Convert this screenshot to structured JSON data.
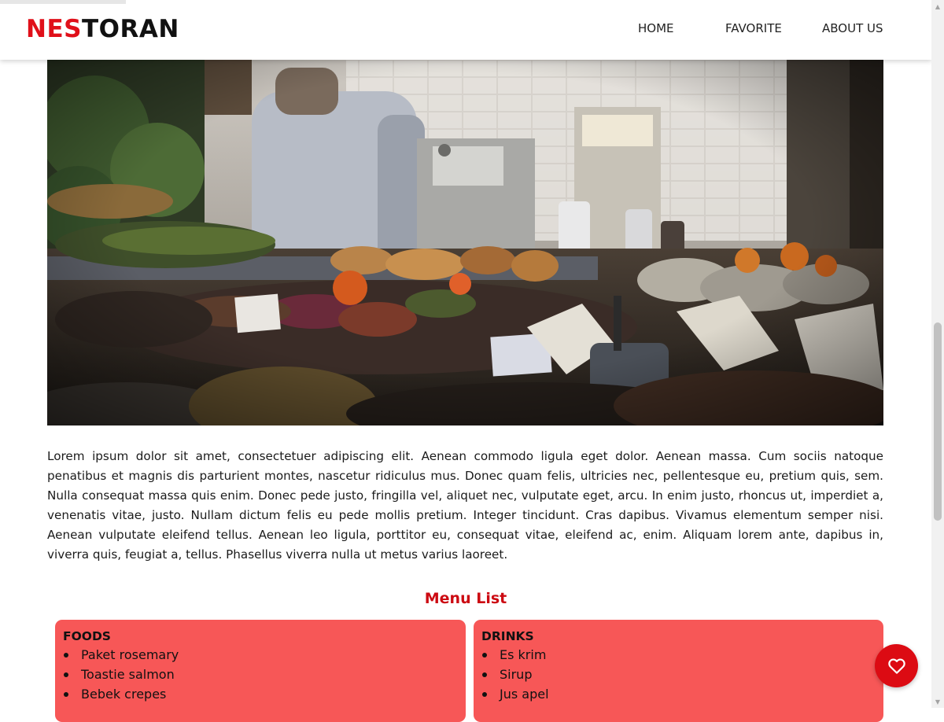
{
  "header": {
    "logo_part1": "NES",
    "logo_part2": "TORAN",
    "nav": {
      "home": "HOME",
      "favorite": "FAVORITE",
      "about": "ABOUT US"
    }
  },
  "hero": {
    "alt": "restaurant kitchen counter with food"
  },
  "description": "Lorem ipsum dolor sit amet, consectetuer adipiscing elit. Aenean commodo ligula eget dolor. Aenean massa. Cum sociis natoque penatibus et magnis dis parturient montes, nascetur ridiculus mus. Donec quam felis, ultricies nec, pellentesque eu, pretium quis, sem. Nulla consequat massa quis enim. Donec pede justo, fringilla vel, aliquet nec, vulputate eget, arcu. In enim justo, rhoncus ut, imperdiet a, venenatis vitae, justo. Nullam dictum felis eu pede mollis pretium. Integer tincidunt. Cras dapibus. Vivamus elementum semper nisi. Aenean vulputate eleifend tellus. Aenean leo ligula, porttitor eu, consequat vitae, eleifend ac, enim. Aliquam lorem ante, dapibus in, viverra quis, feugiat a, tellus. Phasellus viverra nulla ut metus varius laoreet.",
  "menu": {
    "title": "Menu List",
    "foods": {
      "heading": "FOODS",
      "items": [
        "Paket rosemary",
        "Toastie salmon",
        "Bebek crepes"
      ]
    },
    "drinks": {
      "heading": "DRINKS",
      "items": [
        "Es krim",
        "Sirup",
        "Jus apel"
      ]
    }
  },
  "fab": {
    "icon": "heart-icon"
  },
  "colors": {
    "brand_red": "#e0101a",
    "card_bg": "#f75757",
    "fab_bg": "#dc0b13",
    "title_red": "#cc0a12"
  }
}
